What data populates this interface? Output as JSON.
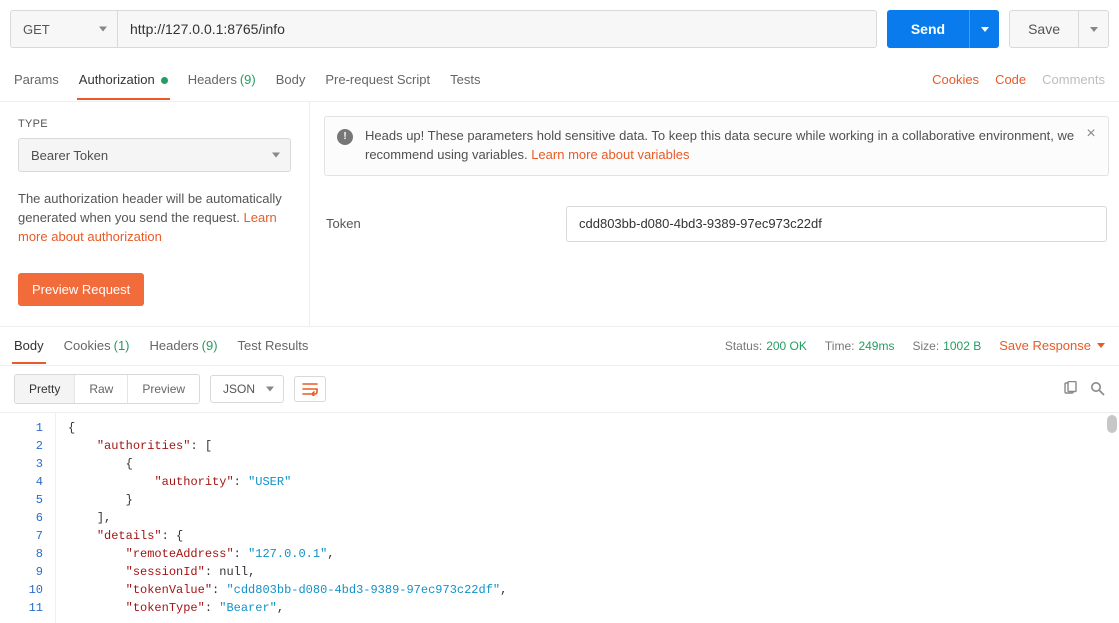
{
  "request": {
    "method": "GET",
    "url": "http://127.0.0.1:8765/info",
    "send_label": "Send",
    "save_label": "Save"
  },
  "req_tabs": {
    "params": "Params",
    "authorization": "Authorization",
    "headers": "Headers",
    "headers_count": "(9)",
    "body": "Body",
    "pre_request_script": "Pre-request Script",
    "tests": "Tests"
  },
  "req_links": {
    "cookies": "Cookies",
    "code": "Code",
    "comments": "Comments"
  },
  "auth": {
    "type_label": "TYPE",
    "type_value": "Bearer Token",
    "desc_before": "The authorization header will be automatically generated when you send the request. ",
    "desc_link": "Learn more about authorization",
    "preview_label": "Preview Request",
    "callout_text_before": "Heads up! These parameters hold sensitive data. To keep this data secure while working in a collaborative environment, we recommend using variables. ",
    "callout_link": "Learn more about variables",
    "token_label": "Token",
    "token_value": "cdd803bb-d080-4bd3-9389-97ec973c22df"
  },
  "resp_tabs": {
    "body": "Body",
    "cookies": "Cookies",
    "cookies_count": "(1)",
    "headers": "Headers",
    "headers_count": "(9)",
    "test_results": "Test Results"
  },
  "status": {
    "status_label": "Status:",
    "status_value": "200 OK",
    "time_label": "Time:",
    "time_value": "249ms",
    "size_label": "Size:",
    "size_value": "1002 B",
    "save_response": "Save Response"
  },
  "body_toolbar": {
    "pretty": "Pretty",
    "raw": "Raw",
    "preview": "Preview",
    "json": "JSON"
  },
  "response_json": {
    "authorities": [
      {
        "authority": "USER"
      }
    ],
    "details": {
      "remoteAddress": "127.0.0.1",
      "sessionId": null,
      "tokenValue": "cdd803bb-d080-4bd3-9389-97ec973c22df",
      "tokenType": "Bearer"
    }
  },
  "code_lines": [
    "{",
    "    \"authorities\": [",
    "        {",
    "            \"authority\": \"USER\"",
    "        }",
    "    ],",
    "    \"details\": {",
    "        \"remoteAddress\": \"127.0.0.1\",",
    "        \"sessionId\": null,",
    "        \"tokenValue\": \"cdd803bb-d080-4bd3-9389-97ec973c22df\",",
    "        \"tokenType\": \"Bearer\","
  ]
}
